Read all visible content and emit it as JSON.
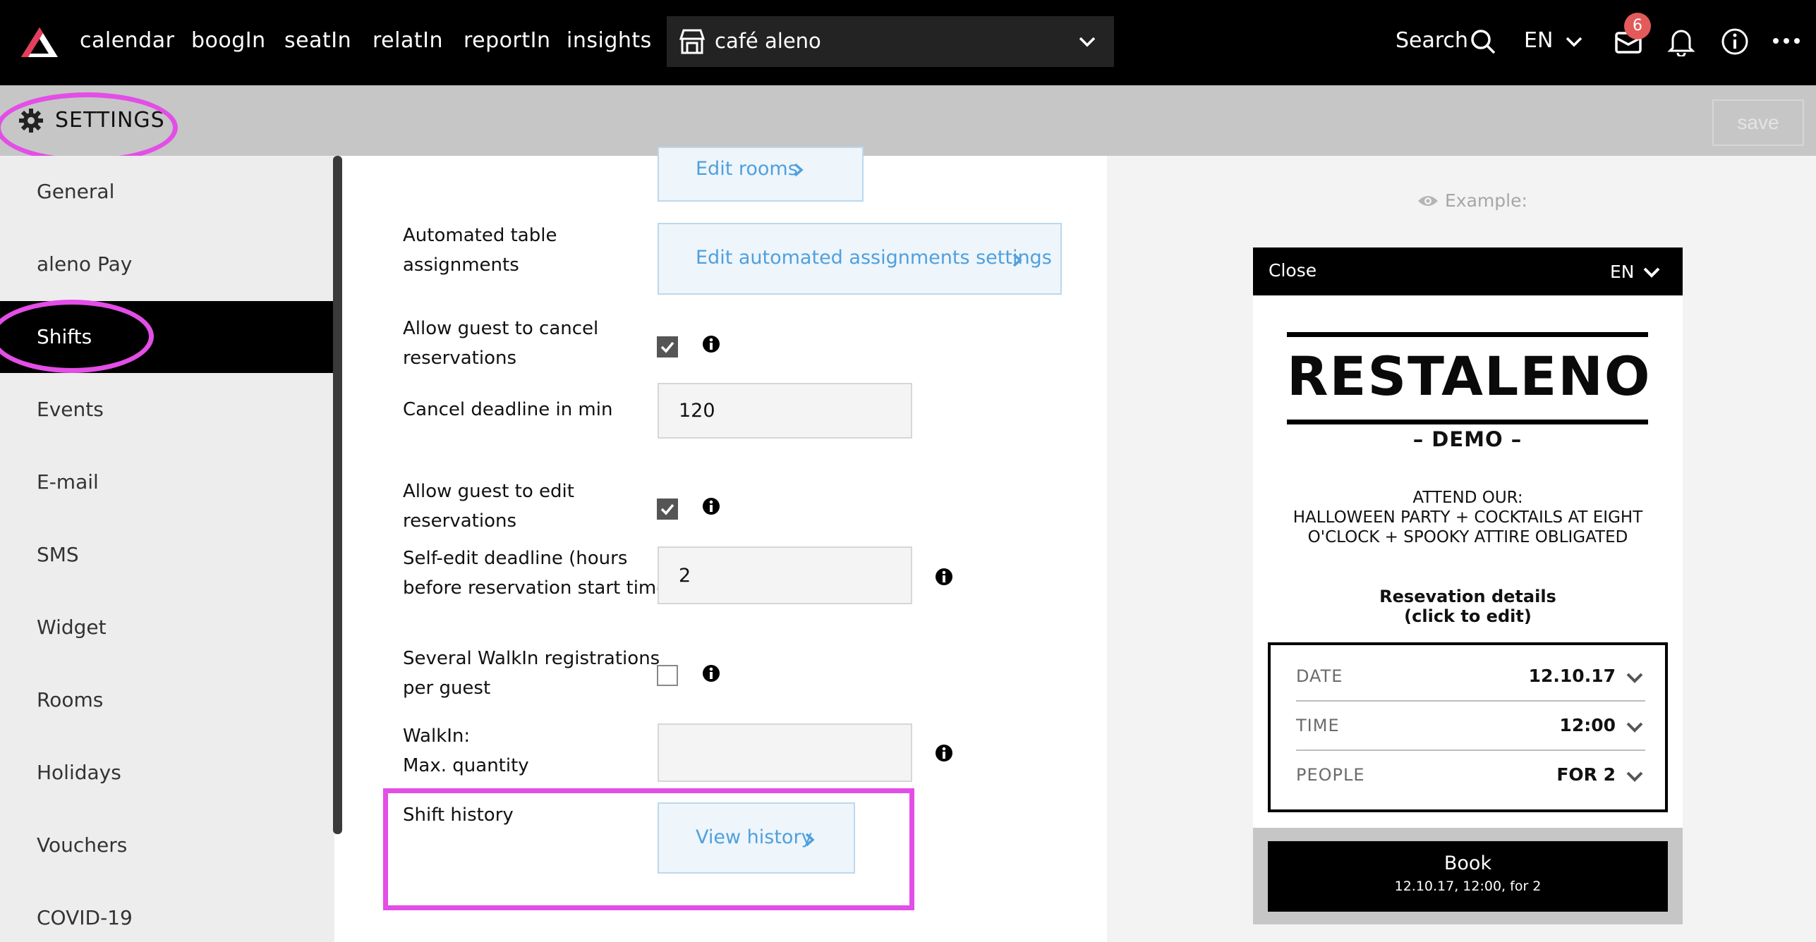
{
  "topbar": {
    "nav": [
      "calendar",
      "boogIn",
      "seatIn",
      "relatIn",
      "reportIn",
      "insights"
    ],
    "venue": "café aleno",
    "search_label": "Search",
    "language": "EN",
    "mail_badge": "6"
  },
  "settings": {
    "title": "SETTINGS",
    "save_label": "save"
  },
  "sidebar": {
    "items": [
      {
        "label": "General"
      },
      {
        "label": "aleno Pay"
      },
      {
        "label": "Shifts"
      },
      {
        "label": "Events"
      },
      {
        "label": "E-mail"
      },
      {
        "label": "SMS"
      },
      {
        "label": "Widget"
      },
      {
        "label": "Rooms"
      },
      {
        "label": "Holidays"
      },
      {
        "label": "Vouchers"
      },
      {
        "label": "COVID-19"
      }
    ],
    "active": "Shifts"
  },
  "form": {
    "edit_rooms_label": "Edit rooms",
    "automated_label_l1": "Automated table",
    "automated_label_l2": "assignments",
    "automated_button": "Edit automated assignments settings",
    "cancel_label_l1": "Allow guest to cancel",
    "cancel_label_l2": "reservations",
    "cancel_checked": true,
    "cancel_deadline_label": "Cancel deadline in min",
    "cancel_deadline_value": "120",
    "edit_label_l1": "Allow guest to edit",
    "edit_label_l2": "reservations",
    "edit_checked": true,
    "self_edit_label_l1": "Self-edit deadline (hours",
    "self_edit_label_l2": "before reservation start time)",
    "self_edit_value": "2",
    "walkin_label_l1": "Several WalkIn registrations",
    "walkin_label_l2": "per guest",
    "walkin_checked": false,
    "walkin_max_label_l1": "WalkIn:",
    "walkin_max_label_l2": "Max. quantity",
    "walkin_max_value": "",
    "shift_history_label": "Shift history",
    "view_history_button": "View history"
  },
  "preview": {
    "example_label": "Example:",
    "close_label": "Close",
    "language": "EN",
    "brand": "RESTALENO",
    "brand_sub": "– DEMO –",
    "announce_l1": "ATTEND OUR:",
    "announce_l2": "HALLOWEEN PARTY + COCKTAILS AT EIGHT",
    "announce_l3": "O'CLOCK + SPOOKY ATTIRE OBLIGATED",
    "details_l1": "Resevation details",
    "details_l2": "(click to edit)",
    "rows": [
      {
        "key": "DATE",
        "value": "12.10.17"
      },
      {
        "key": "TIME",
        "value": "12:00"
      },
      {
        "key": "PEOPLE",
        "value": "FOR 2"
      }
    ],
    "book_label": "Book",
    "book_detail": "12.10.17, 12:00, for 2"
  },
  "colors": {
    "accent_highlight": "#e34ee6",
    "link": "#4fa0de",
    "badge": "#e35a5a"
  }
}
